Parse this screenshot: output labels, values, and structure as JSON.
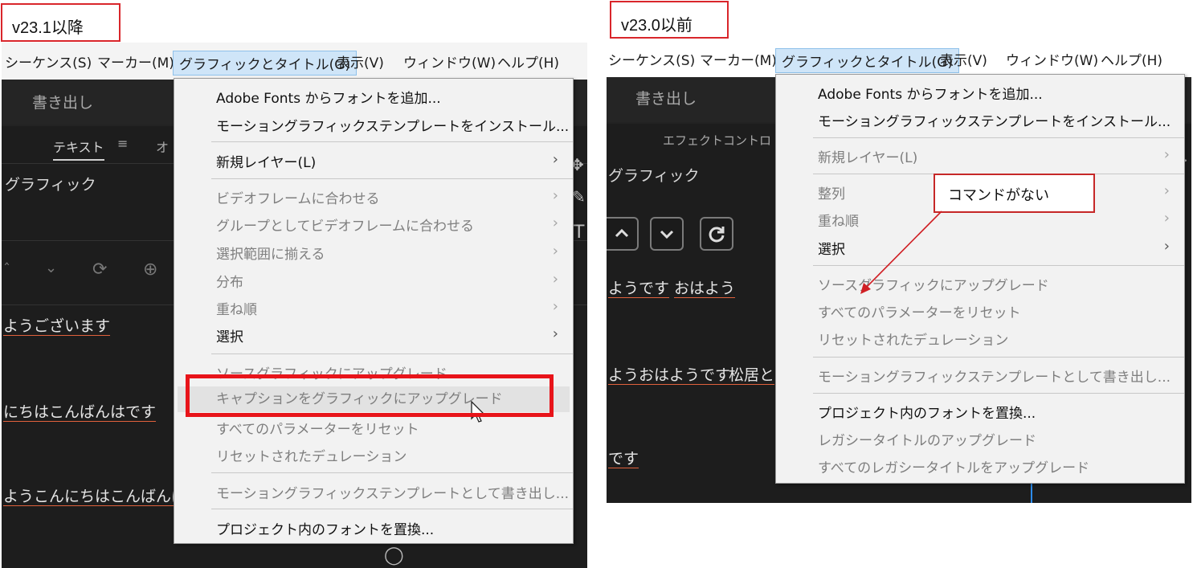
{
  "left_label": "v23.1以降",
  "right_label": "v23.0以前",
  "callout": "コマンドがない",
  "left": {
    "menubar": [
      "シーケンス(S)",
      "マーカー(M)",
      "グラフィックとタイトル(G)",
      "表示(V)",
      "ウィンドウ(W)",
      "ヘルプ(H)"
    ],
    "export_label": "書き出し",
    "tab_text": "テキスト",
    "tab_partial": "オ",
    "panel_title": "グラフィック",
    "rows": [
      "ようございます",
      "にちはこんばんはです",
      "ようこんにちはこんばんは"
    ],
    "menu": [
      "Adobe Fonts からフォントを追加...",
      "モーショングラフィックステンプレートをインストール...",
      "新規レイヤー(L)",
      "ビデオフレームに合わせる",
      "グループとしてビデオフレームに合わせる",
      "選択範囲に揃える",
      "分布",
      "重ね順",
      "選択",
      "ソースグラフィックにアップグレード",
      "キャプションをグラフィックにアップグレード",
      "すべてのパラメーターをリセット",
      "リセットされたデュレーション",
      "モーショングラフィックステンプレートとして書き出し...",
      "プロジェクト内のフォントを置換..."
    ]
  },
  "right": {
    "menubar": [
      "シーケンス(S)",
      "マーカー(M)",
      "グラフィックとタイトル(G)",
      "表示(V)",
      "ウィンドウ(W)",
      "ヘルプ(H)"
    ],
    "export_label": "書き出し",
    "tab_effect": "エフェクトコントロ",
    "panel_title": "グラフィック",
    "rows": [
      [
        "ようです",
        "おはよう"
      ],
      [
        "ようおはようです",
        "松居と"
      ],
      [
        "です"
      ]
    ],
    "menu": [
      "Adobe Fonts からフォントを追加...",
      "モーショングラフィックステンプレートをインストール...",
      "新規レイヤー(L)",
      "整列",
      "重ね順",
      "選択",
      "ソースグラフィックにアップグレード",
      "すべてのパラメーターをリセット",
      "リセットされたデュレーション",
      "モーショングラフィックステンプレートとして書き出し...",
      "プロジェクト内のフォントを置換...",
      "レガシータイトルのアップグレード",
      "すべてのレガシータイトルをアップグレード"
    ]
  },
  "colors": {
    "highlight_red": "#e8141a",
    "dark_panel": "#1d1d1d",
    "menu_bg": "#f2f2f2"
  }
}
